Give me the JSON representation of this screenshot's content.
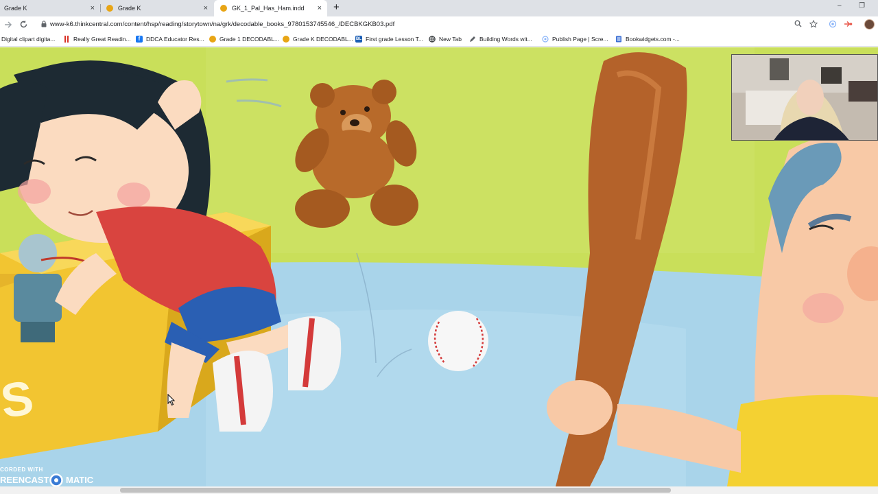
{
  "tabs": [
    {
      "label": "Grade K",
      "active": false
    },
    {
      "label": "Grade K",
      "active": false
    },
    {
      "label": "GK_1_Pal_Has_Ham.indd",
      "active": true
    }
  ],
  "new_tab_symbol": "+",
  "tab_close_symbol": "×",
  "window_controls": {
    "minimize": "–",
    "restore": "❐"
  },
  "address_bar": {
    "url": "www-k6.thinkcentral.com/content/hsp/reading/storytown/na/grk/decodable_books_9780153745546_/DECBKGKB03.pdf"
  },
  "nav_icons": {
    "back": "arrow-left-icon",
    "forward": "arrow-right-icon",
    "reload": "reload-icon"
  },
  "bookmarks": [
    {
      "label": "Digital clipart digita...",
      "icon": "none"
    },
    {
      "label": "Really Great Readin...",
      "icon": "bars-red"
    },
    {
      "label": "DDCA Educator Res...",
      "icon": "facebook",
      "color": "#1877f2"
    },
    {
      "label": "Grade 1 DECODABL...",
      "icon": "dot",
      "color": "#e8a515"
    },
    {
      "label": "Grade K DECODABL...",
      "icon": "dot",
      "color": "#e8a515"
    },
    {
      "label": "First grade Lesson T...",
      "icon": "square",
      "color": "#1c5fb5"
    },
    {
      "label": "New Tab",
      "icon": "globe"
    },
    {
      "label": "Building Words wit...",
      "icon": "pencil"
    },
    {
      "label": "Publish Page | Scre...",
      "icon": "ring"
    },
    {
      "label": "Bookwidgets.com -...",
      "icon": "doc",
      "color": "#3b6fd4"
    }
  ],
  "colors": {
    "tab_dot": "#e8a515",
    "tabbar_bg": "#dee1e6",
    "wall": "#c7dd55",
    "floor": "#a9d4ea"
  },
  "watermark": {
    "line1": "CORDED WITH",
    "line2": "REENCAST",
    "line3": "MATIC"
  }
}
